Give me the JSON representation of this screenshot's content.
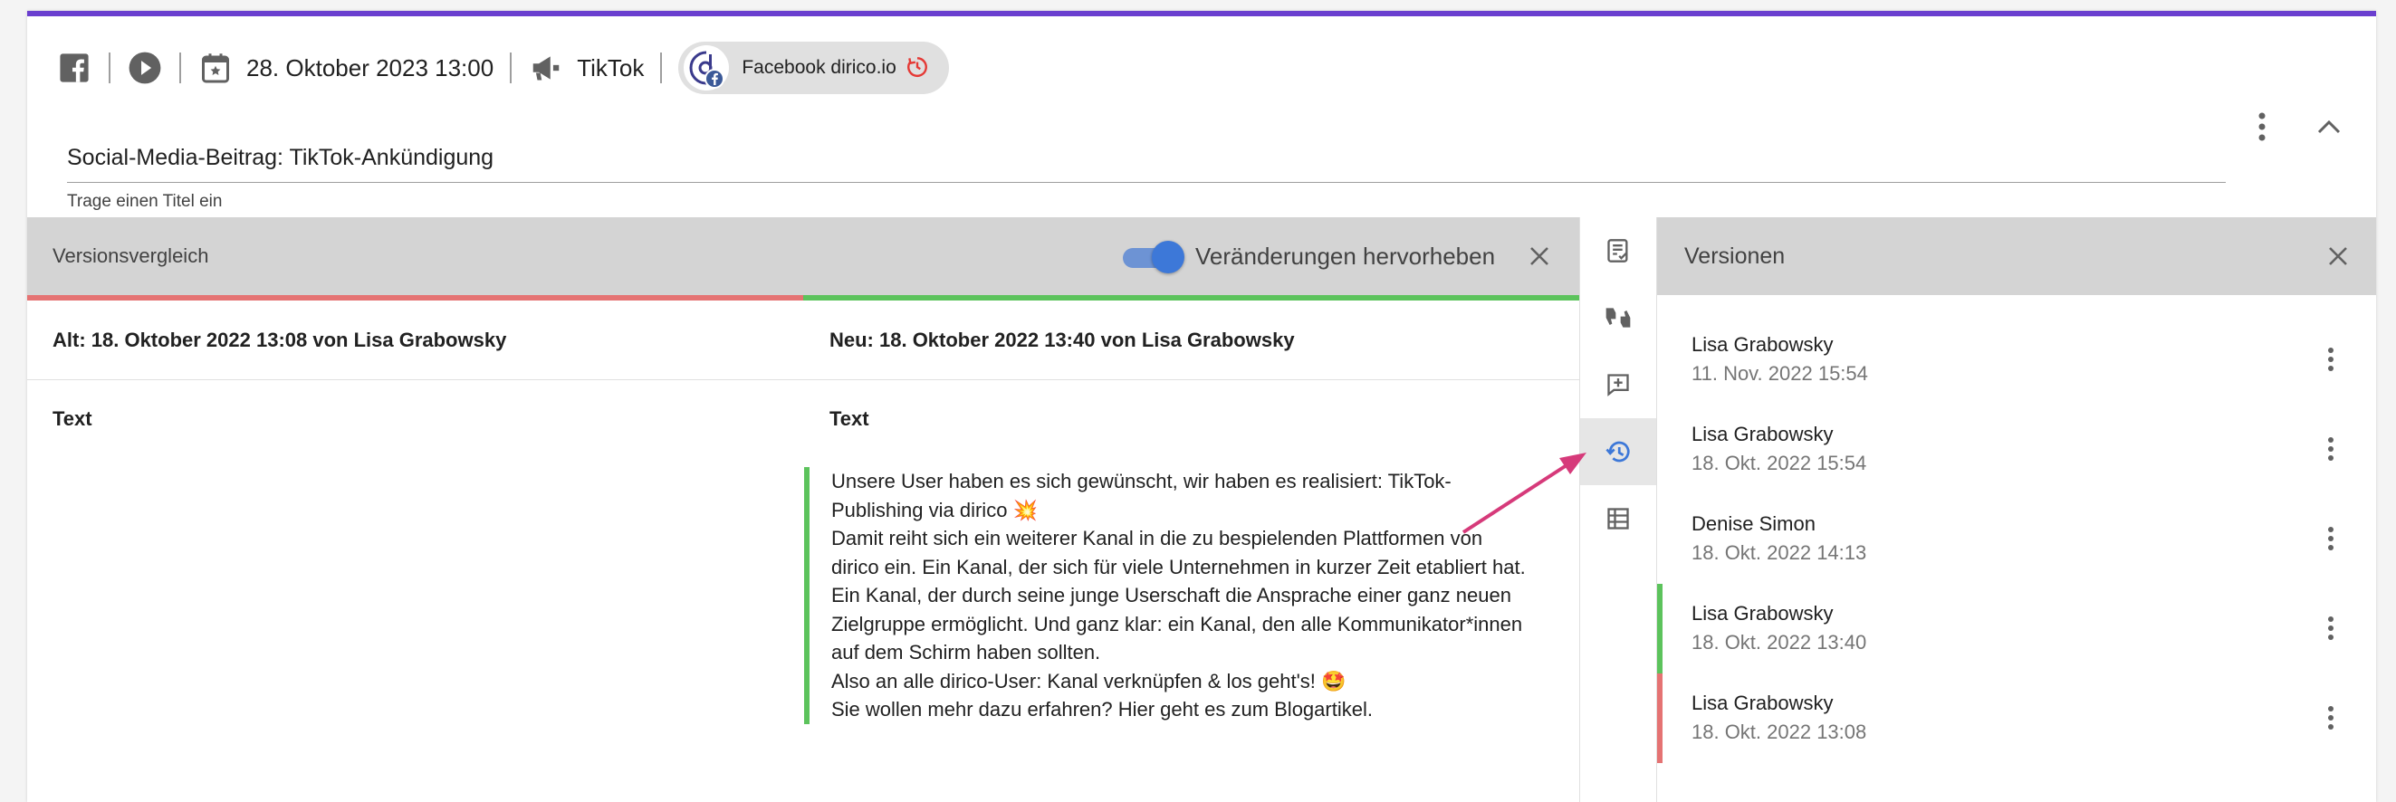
{
  "toolbar": {
    "platform_icon": "facebook-icon",
    "date_text": "28. Oktober 2023 13:00",
    "channel_label": "TikTok",
    "account_chip_label": "Facebook dirico.io"
  },
  "post": {
    "title_value": "Social-Media-Beitrag: TikTok-Ankündigung",
    "title_hint": "Trage einen Titel ein"
  },
  "compare": {
    "panel_title": "Versionsvergleich",
    "highlight_toggle_label": "Veränderungen hervorheben",
    "highlight_toggle_on": true,
    "old_version_label": "Alt: 18. Oktober 2022 13:08 von Lisa Grabowsky",
    "new_version_label": "Neu: 18. Oktober 2022 13:40 von Lisa Grabowsky",
    "old_field_label": "Text",
    "new_field_label": "Text",
    "new_text_lines": [
      "Unsere User haben es sich gewünscht, wir haben es realisiert: TikTok-",
      "Publishing via dirico 💥",
      "Damit reiht sich ein weiterer Kanal in die zu bespielenden Plattformen von",
      "dirico ein. Ein Kanal, der sich für viele Unternehmen in kurzer Zeit etabliert hat.",
      "Ein Kanal, der durch seine junge Userschaft die Ansprache einer ganz neuen",
      "Zielgruppe ermöglicht. Und ganz klar: ein Kanal, den alle Kommunikator*innen",
      "auf dem Schirm haben sollten.",
      "Also an alle dirico-User: Kanal verknüpfen & los geht's! 🤩",
      "Sie wollen mehr dazu erfahren? Hier geht es zum Blogartikel."
    ]
  },
  "rail": {
    "items": [
      {
        "icon": "checklist-icon",
        "active": false
      },
      {
        "icon": "thumbs-icon",
        "active": false
      },
      {
        "icon": "add-comment-icon",
        "active": false
      },
      {
        "icon": "history-icon",
        "active": true
      },
      {
        "icon": "list-icon",
        "active": false
      }
    ]
  },
  "versions": {
    "panel_title": "Versionen",
    "items": [
      {
        "author": "Lisa Grabowsky",
        "date": "11. Nov. 2022 15:54",
        "marker": ""
      },
      {
        "author": "Lisa Grabowsky",
        "date": "18. Okt. 2022 15:54",
        "marker": ""
      },
      {
        "author": "Denise Simon",
        "date": "18. Okt. 2022 14:13",
        "marker": ""
      },
      {
        "author": "Lisa Grabowsky",
        "date": "18. Okt. 2022 13:40",
        "marker": "#5cc35c"
      },
      {
        "author": "Lisa Grabowsky",
        "date": "18. Okt. 2022 13:08",
        "marker": "#e57373"
      }
    ]
  },
  "colors": {
    "accent_top": "#6a3fcf",
    "toggle_blue": "#3d78d8",
    "old_red": "#e57373",
    "new_green": "#5cc35c",
    "arrow_pink": "#d63a7a"
  }
}
